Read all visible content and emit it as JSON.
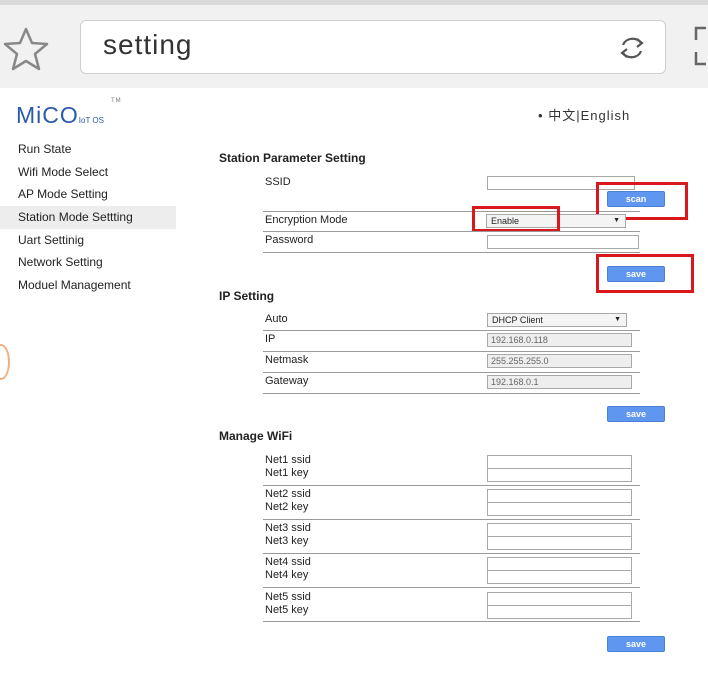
{
  "browser": {
    "address_text": "setting",
    "icons": [
      "star-icon",
      "reload-icon",
      "frame-icon"
    ]
  },
  "logo": {
    "main": "MiCO",
    "sub": "IoT OS",
    "tm": "TM"
  },
  "language": {
    "bullet": "•",
    "text": "中文|English"
  },
  "sidebar": {
    "items": [
      {
        "label": "Run State"
      },
      {
        "label": "Wifi Mode Select"
      },
      {
        "label": "AP Mode Setting"
      },
      {
        "label": "Station Mode Settting"
      },
      {
        "label": "Uart Settinig"
      },
      {
        "label": "Network Setting"
      },
      {
        "label": "Moduel Management"
      }
    ],
    "active_index": 3
  },
  "station": {
    "title": "Station Parameter Setting",
    "ssid_label": "SSID",
    "ssid_value": "",
    "scan_label": "scan",
    "encryption_label": "Encryption Mode",
    "encryption_value": "Enable",
    "password_label": "Password",
    "password_value": "",
    "save_label": "save"
  },
  "ip": {
    "title": "IP Setting",
    "auto_label": "Auto",
    "auto_value": "DHCP Client",
    "ip_label": "IP",
    "ip_value": "192.168.0.118",
    "netmask_label": "Netmask",
    "netmask_value": "255.255.255.0",
    "gateway_label": "Gateway",
    "gateway_value": "192.168.0.1",
    "save_label": "save"
  },
  "wifi": {
    "title": "Manage WiFi",
    "nets": [
      {
        "ssid_label": "Net1 ssid",
        "key_label": "Net1 key"
      },
      {
        "ssid_label": "Net2 ssid",
        "key_label": "Net2 key"
      },
      {
        "ssid_label": "Net3 ssid",
        "key_label": "Net3 key"
      },
      {
        "ssid_label": "Net4 ssid",
        "key_label": "Net4 key"
      },
      {
        "ssid_label": "Net5 ssid",
        "key_label": "Net5 key"
      }
    ],
    "save_label": "save"
  },
  "colors": {
    "button": "#5f97f0",
    "highlight": "#d9181e",
    "logo": "#2a5aa8"
  }
}
